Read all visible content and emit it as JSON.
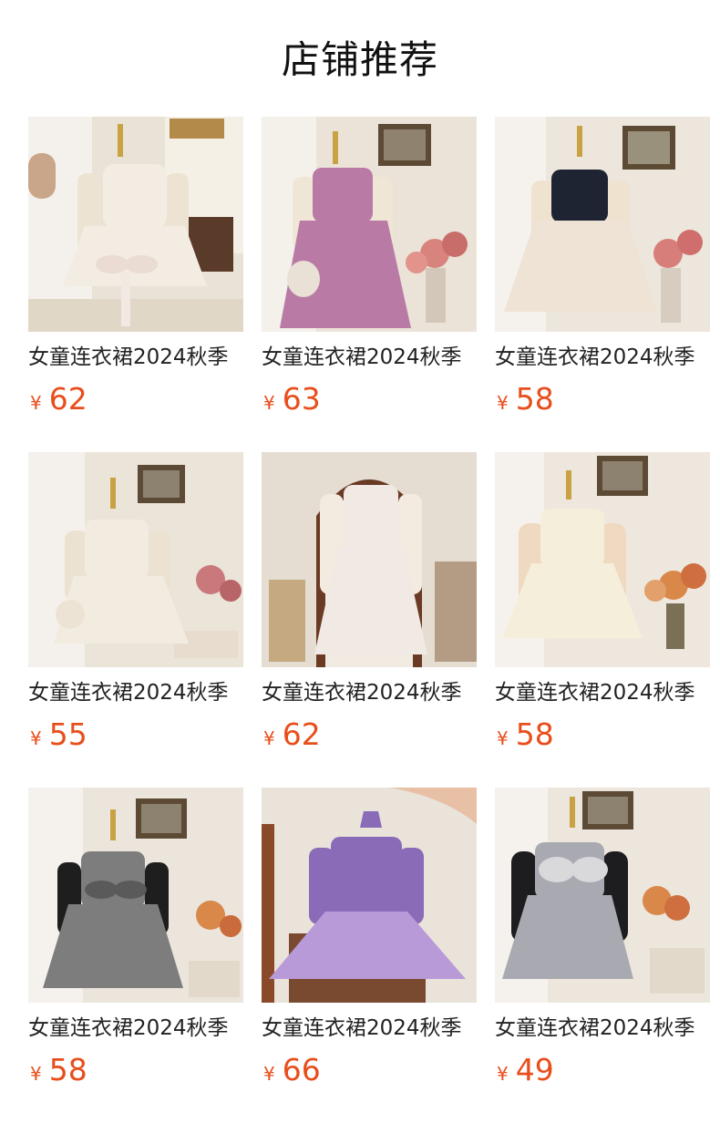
{
  "title": "店铺推荐",
  "products": [
    {
      "name": "女童连衣裙2024秋季",
      "currency": "¥",
      "price": "62",
      "image": "cream-tutu-dress-with-bow-bag",
      "dress_color": "#f3ece2",
      "sleeve_color": "#ede3d3"
    },
    {
      "name": "女童连衣裙2024秋季",
      "currency": "¥",
      "price": "63",
      "image": "mauve-ruffle-dress-with-pearl-bag",
      "dress_color": "#b97ba6",
      "sleeve_color": "#efe6d6"
    },
    {
      "name": "女童连衣裙2024秋季",
      "currency": "¥",
      "price": "58",
      "image": "navy-sequin-tulle-dress",
      "dress_color": "#efe3d6",
      "sleeve_color": "#efe2cf"
    },
    {
      "name": "女童连衣裙2024秋季",
      "currency": "¥",
      "price": "55",
      "image": "ivory-lace-tulle-dress",
      "dress_color": "#f2ece0",
      "sleeve_color": "#ece2d2"
    },
    {
      "name": "女童连衣裙2024秋季",
      "currency": "¥",
      "price": "62",
      "image": "pink-sequin-tiered-dress",
      "dress_color": "#f1e9e3",
      "sleeve_color": "#f4ebe0"
    },
    {
      "name": "女童连衣裙2024秋季",
      "currency": "¥",
      "price": "58",
      "image": "peach-puff-sleeve-tulle-dress",
      "dress_color": "#f5eedb",
      "sleeve_color": "#efd9c0"
    },
    {
      "name": "女童连衣裙2024秋季",
      "currency": "¥",
      "price": "58",
      "image": "grey-ruffle-dress-with-bow",
      "dress_color": "#7d7d7d",
      "sleeve_color": "#1e1e1e"
    },
    {
      "name": "女童连衣裙2024秋季",
      "currency": "¥",
      "price": "66",
      "image": "purple-sequin-tiered-dress",
      "dress_color": "#b99ad9",
      "sleeve_color": "#8a6bb8"
    },
    {
      "name": "女童连衣裙2024秋季",
      "currency": "¥",
      "price": "49",
      "image": "grey-tulle-dress-black-sleeves",
      "dress_color": "#a9aab1",
      "sleeve_color": "#1d1d1f"
    }
  ]
}
